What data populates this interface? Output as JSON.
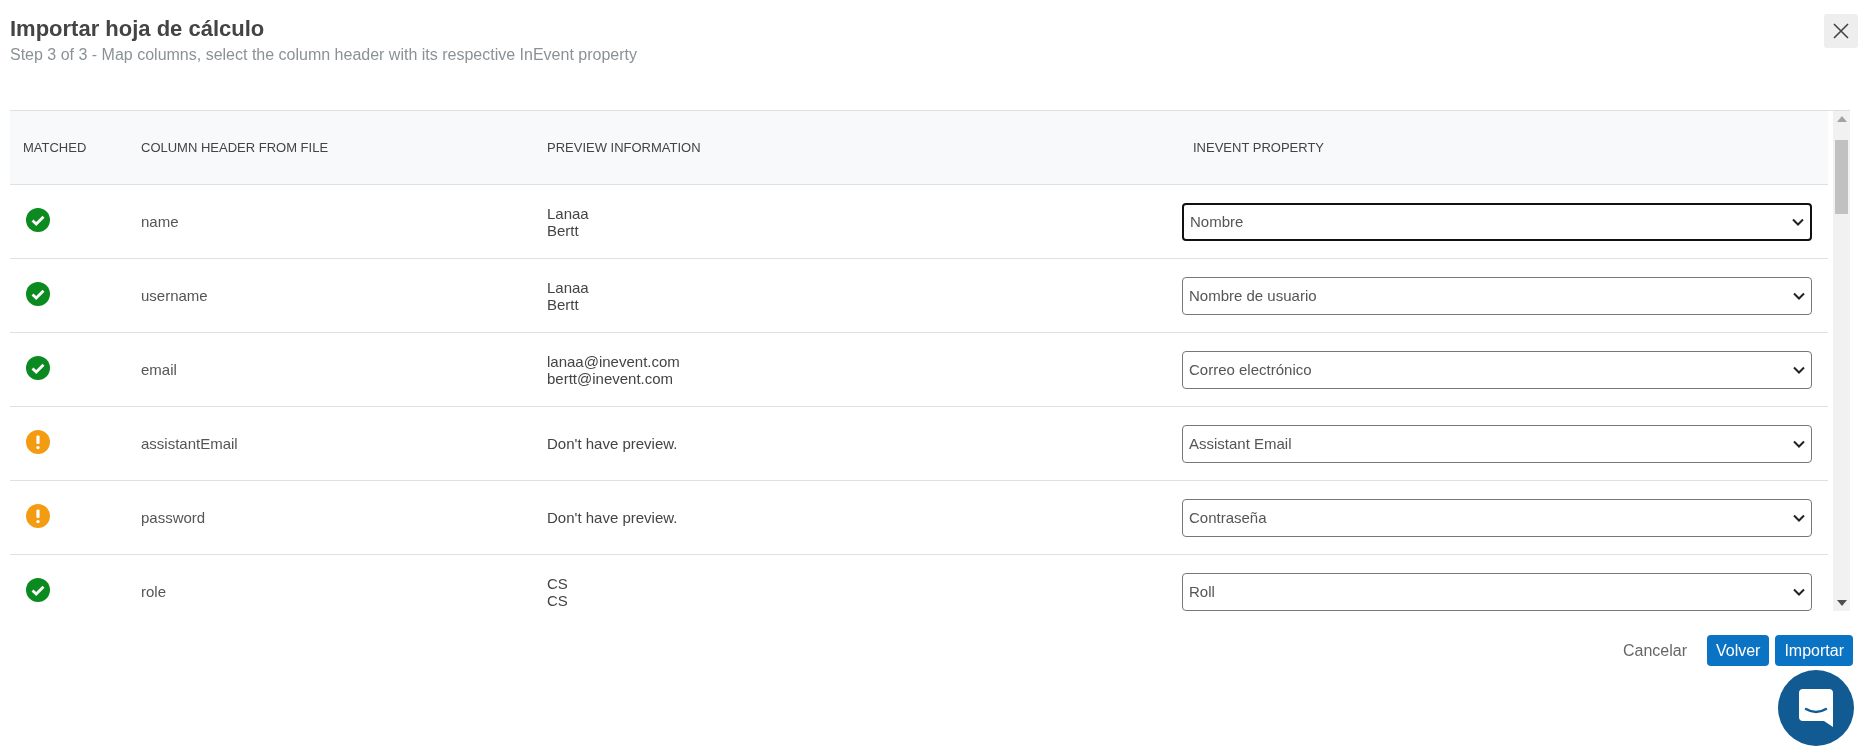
{
  "dialog": {
    "title": "Importar hoja de cálculo",
    "subtitle": "Step 3 of 3 - Map columns, select the column header with its respective InEvent property"
  },
  "table": {
    "columns": [
      "MATCHED",
      "COLUMN HEADER FROM FILE",
      "PREVIEW INFORMATION",
      "INEVENT PROPERTY"
    ],
    "rows": [
      {
        "matched": true,
        "header": "name",
        "preview": [
          "Lanaa",
          "Bertt"
        ],
        "property": "Nombre",
        "focused": true
      },
      {
        "matched": true,
        "header": "username",
        "preview": [
          "Lanaa",
          "Bertt"
        ],
        "property": "Nombre de usuario",
        "focused": false
      },
      {
        "matched": true,
        "header": "email",
        "preview": [
          "lanaa@inevent.com",
          "bertt@inevent.com"
        ],
        "property": "Correo electrónico",
        "focused": false
      },
      {
        "matched": false,
        "header": "assistantEmail",
        "preview": [
          "Don't have preview."
        ],
        "property": "Assistant Email",
        "focused": false
      },
      {
        "matched": false,
        "header": "password",
        "preview": [
          "Don't have preview."
        ],
        "property": "Contraseña",
        "focused": false
      },
      {
        "matched": true,
        "header": "role",
        "preview": [
          "CS",
          "CS"
        ],
        "property": "Roll",
        "focused": false
      }
    ]
  },
  "footer": {
    "cancel": "Cancelar",
    "back": "Volver",
    "import": "Importar"
  }
}
